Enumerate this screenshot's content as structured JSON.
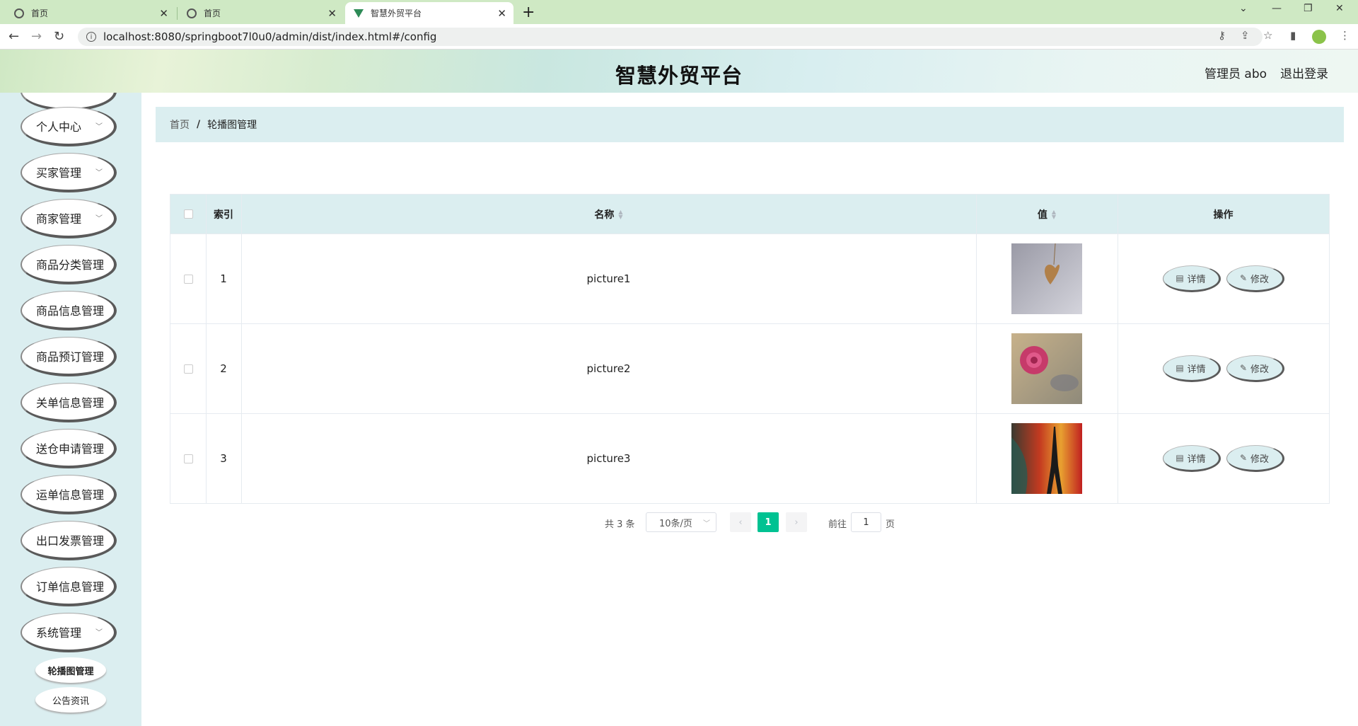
{
  "browser": {
    "tabs": [
      {
        "title": "首页"
      },
      {
        "title": "首页"
      },
      {
        "title": "智慧外贸平台"
      }
    ],
    "url": "localhost:8080/springboot7l0u0/admin/dist/index.html#/config"
  },
  "header": {
    "title": "智慧外贸平台",
    "user_label": "管理员 abo",
    "logout_label": "退出登录"
  },
  "sidebar": {
    "items": [
      {
        "label": "个人中心",
        "has_submenu": true
      },
      {
        "label": "买家管理",
        "has_submenu": true
      },
      {
        "label": "商家管理",
        "has_submenu": true
      },
      {
        "label": "商品分类管理",
        "has_submenu": false
      },
      {
        "label": "商品信息管理",
        "has_submenu": false
      },
      {
        "label": "商品预订管理",
        "has_submenu": false
      },
      {
        "label": "关单信息管理",
        "has_submenu": false
      },
      {
        "label": "送仓申请管理",
        "has_submenu": false
      },
      {
        "label": "运单信息管理",
        "has_submenu": false
      },
      {
        "label": "出口发票管理",
        "has_submenu": false
      },
      {
        "label": "订单信息管理",
        "has_submenu": false
      },
      {
        "label": "系统管理",
        "has_submenu": true
      }
    ],
    "subitems": [
      {
        "label": "轮播图管理",
        "active": true
      },
      {
        "label": "公告资讯",
        "active": false
      }
    ]
  },
  "breadcrumb": {
    "home": "首页",
    "separator": "/",
    "current": "轮播图管理"
  },
  "table": {
    "headers": {
      "index": "索引",
      "name": "名称",
      "value": "值",
      "actions": "操作"
    },
    "rows": [
      {
        "index": "1",
        "name": "picture1",
        "image": "heart-pendant-photo"
      },
      {
        "index": "2",
        "name": "picture2",
        "image": "pink-rose-photo"
      },
      {
        "index": "3",
        "name": "picture3",
        "image": "eiffel-tower-photo"
      }
    ],
    "detail_label": "详情",
    "edit_label": "修改"
  },
  "pagination": {
    "total_label": "共 3 条",
    "page_size": "10条/页",
    "current_page": "1",
    "goto_label": "前往",
    "goto_value": "1",
    "page_suffix": "页"
  },
  "colors": {
    "accent": "#00c292",
    "panel_bg": "#dbeef0"
  }
}
